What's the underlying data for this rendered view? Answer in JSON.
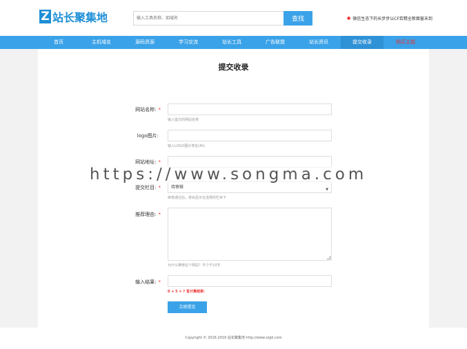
{
  "header": {
    "logo_mark": "Z",
    "logo_text": "站长聚集地",
    "search_placeholder": "输入工具名称、如域名",
    "search_button": "查找",
    "notice": "微信生态下的长步步以CF若精全新面窗未到"
  },
  "nav": {
    "items": [
      {
        "label": "首页"
      },
      {
        "label": "主机域名"
      },
      {
        "label": "源码资源"
      },
      {
        "label": "学习交流"
      },
      {
        "label": "站长工具"
      },
      {
        "label": "广告联盟"
      },
      {
        "label": "站长资讯"
      },
      {
        "label": "提交收录"
      },
      {
        "label": "购买主题"
      }
    ],
    "active_index": 7,
    "hot_index": 8
  },
  "form": {
    "title": "提交收录",
    "site_name": {
      "label": "网站名称:",
      "required": "*",
      "hint": "输入提交的网站名称"
    },
    "logo": {
      "label": "logo图片:",
      "hint": "输入LOGO图片地址URL"
    },
    "site_url": {
      "label": "网站地址:",
      "required": "*"
    },
    "category": {
      "label": "提交栏目:",
      "required": "*",
      "value": "待审核",
      "hint": "审核通过后，将会显示在选择的栏目下"
    },
    "reason": {
      "label": "推荐理由:",
      "required": "*",
      "hint": "为什么推荐这个网站？不少于10字"
    },
    "captcha": {
      "label": "输入结果:",
      "required": "*",
      "question": "0 + 5 = ? 答计算结果:"
    },
    "submit": "立即提交"
  },
  "watermark": "https://www.songma.com",
  "footer": {
    "copyright": "Copyright © 2016-2019 站长聚集地 http://www.zzjjd.com"
  }
}
